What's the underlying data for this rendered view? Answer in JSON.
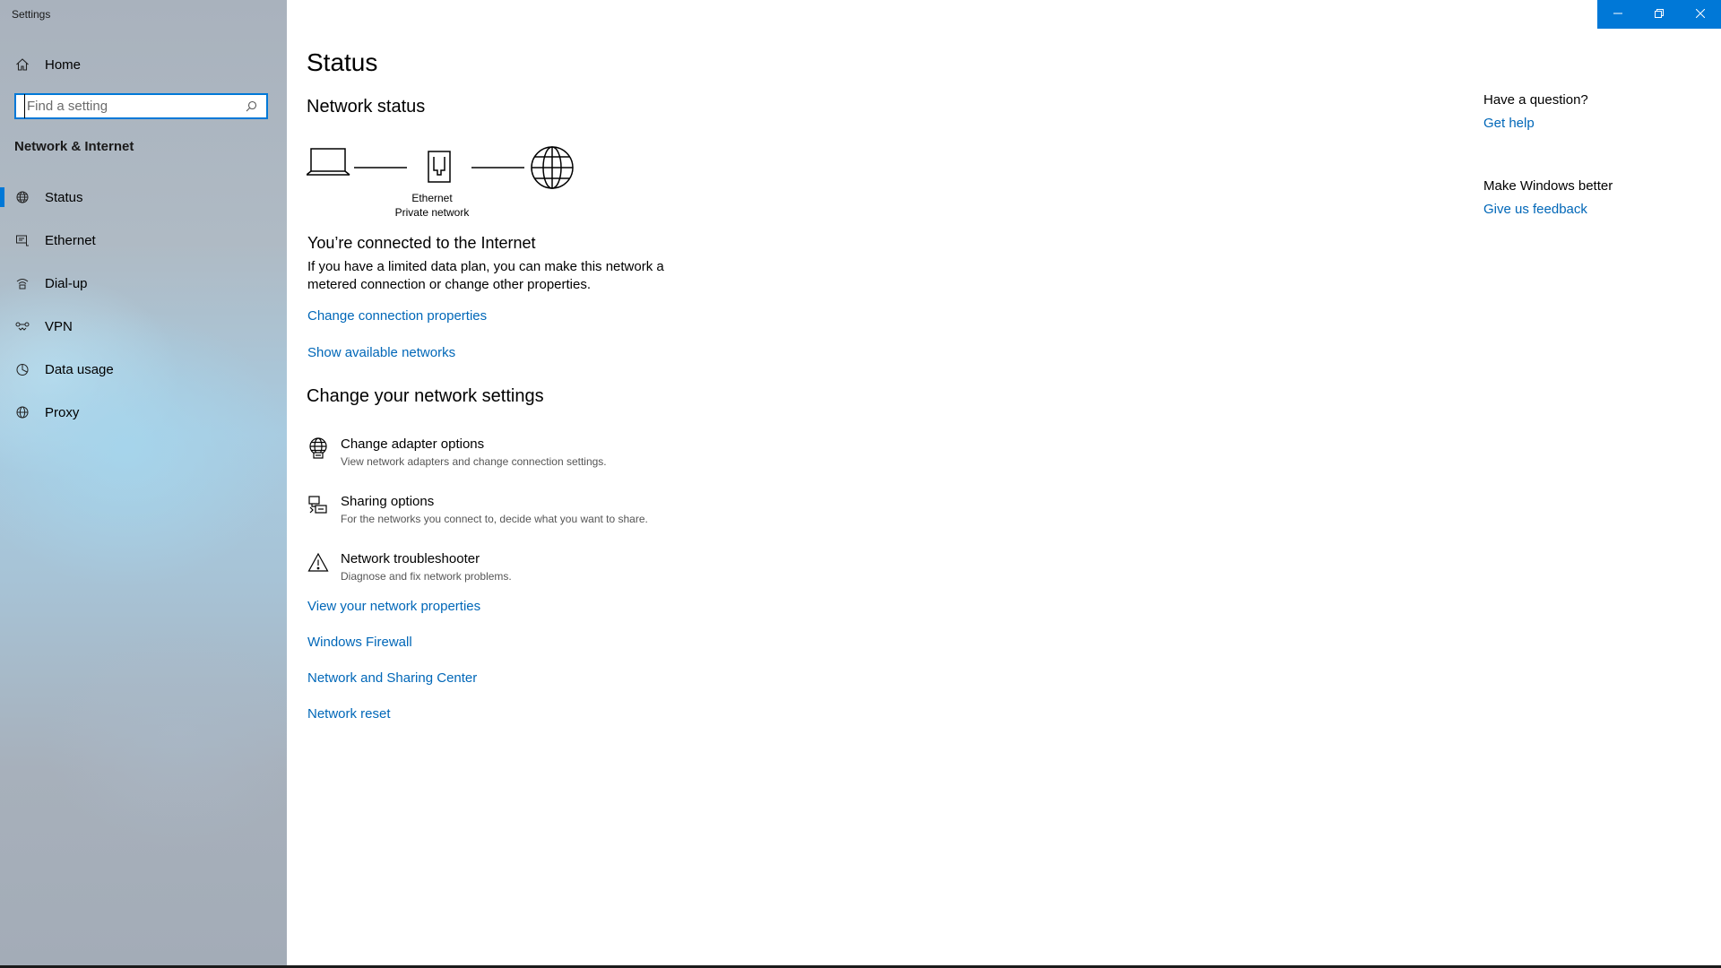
{
  "window": {
    "app_title": "Settings",
    "accent_color": "#0078d7",
    "link_color": "#0067b8",
    "controls": {
      "minimize_icon": "minimize-icon",
      "restore_icon": "restore-icon",
      "close_icon": "close-icon"
    }
  },
  "sidebar": {
    "home_label": "Home",
    "home_icon": "home-icon",
    "search": {
      "placeholder": "Find a setting",
      "value": "",
      "icon": "search-icon"
    },
    "section_title": "Network & Internet",
    "items": [
      {
        "label": "Status",
        "icon": "globe-status-icon",
        "selected": true
      },
      {
        "label": "Ethernet",
        "icon": "ethernet-icon",
        "selected": false
      },
      {
        "label": "Dial-up",
        "icon": "dialup-icon",
        "selected": false
      },
      {
        "label": "VPN",
        "icon": "vpn-icon",
        "selected": false
      },
      {
        "label": "Data usage",
        "icon": "data-usage-icon",
        "selected": false
      },
      {
        "label": "Proxy",
        "icon": "globe-icon",
        "selected": false
      }
    ]
  },
  "main": {
    "title": "Status",
    "network_status": {
      "heading": "Network status",
      "adapter_name": "Ethernet",
      "network_type": "Private network",
      "connected_title": "You’re connected to the Internet",
      "connected_desc": "If you have a limited data plan, you can make this network a metered connection or change other properties.",
      "links": {
        "change_connection": "Change connection properties",
        "show_networks": "Show available networks"
      }
    },
    "change_settings": {
      "heading": "Change your network settings",
      "items": [
        {
          "title": "Change adapter options",
          "desc": "View network adapters and change connection settings.",
          "icon": "adapter-globe-icon"
        },
        {
          "title": "Sharing options",
          "desc": "For the networks you connect to, decide what you want to share.",
          "icon": "sharing-icon"
        },
        {
          "title": "Network troubleshooter",
          "desc": "Diagnose and fix network problems.",
          "icon": "warning-icon"
        }
      ],
      "links": [
        "View your network properties",
        "Windows Firewall",
        "Network and Sharing Center",
        "Network reset"
      ]
    }
  },
  "aside": {
    "question_heading": "Have a question?",
    "get_help": "Get help",
    "better_heading": "Make Windows better",
    "feedback": "Give us feedback"
  }
}
